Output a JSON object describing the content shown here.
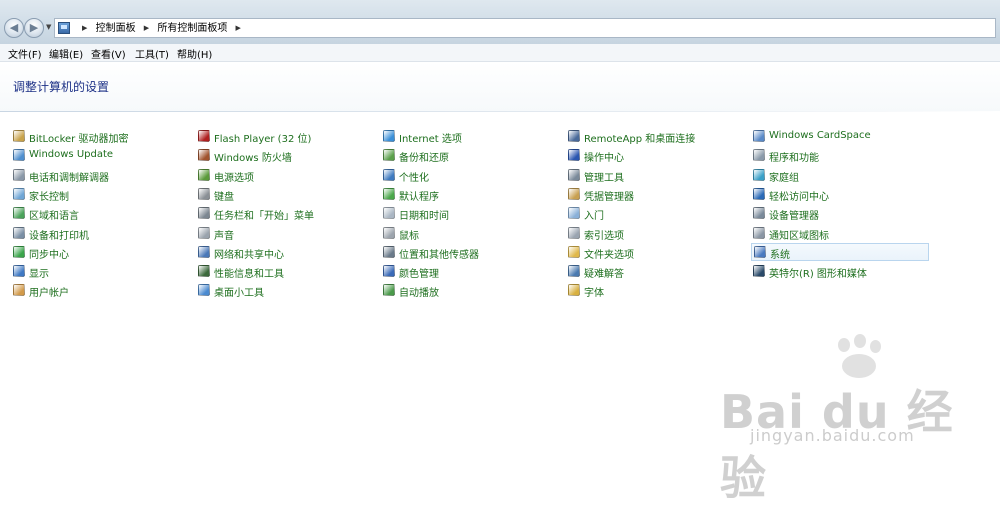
{
  "breadcrumb": [
    "控制面板",
    "所有控制面板项"
  ],
  "menu": [
    "文件(F)",
    "编辑(E)",
    "查看(V)",
    "工具(T)",
    "帮助(H)"
  ],
  "page_title": "调整计算机的设置",
  "columns": [
    [
      {
        "label": "BitLocker 驱动器加密",
        "icon": "bitlocker-icon",
        "color": "#c8a24a"
      },
      {
        "label": "Windows Update",
        "icon": "windows-update-icon",
        "color": "#4f8fcf"
      },
      {
        "label": "电话和调制解调器",
        "icon": "phone-modem-icon",
        "color": "#8a98a8"
      },
      {
        "label": "家长控制",
        "icon": "parental-controls-icon",
        "color": "#6fa6d6"
      },
      {
        "label": "区域和语言",
        "icon": "region-language-icon",
        "color": "#4aa35a"
      },
      {
        "label": "设备和打印机",
        "icon": "devices-printers-icon",
        "color": "#7a8fa5"
      },
      {
        "label": "同步中心",
        "icon": "sync-center-icon",
        "color": "#3aa54a"
      },
      {
        "label": "显示",
        "icon": "display-icon",
        "color": "#3f79c4"
      },
      {
        "label": "用户帐户",
        "icon": "user-accounts-icon",
        "color": "#d29a4a"
      }
    ],
    [
      {
        "label": "Flash Player (32 位)",
        "icon": "flash-player-icon",
        "color": "#b02020"
      },
      {
        "label": "Windows 防火墙",
        "icon": "firewall-icon",
        "color": "#a0522d"
      },
      {
        "label": "电源选项",
        "icon": "power-options-icon",
        "color": "#5a9a3a"
      },
      {
        "label": "键盘",
        "icon": "keyboard-icon",
        "color": "#8a8f95"
      },
      {
        "label": "任务栏和「开始」菜单",
        "icon": "taskbar-icon",
        "color": "#7d8791"
      },
      {
        "label": "声音",
        "icon": "sound-icon",
        "color": "#9aa3ad"
      },
      {
        "label": "网络和共享中心",
        "icon": "network-sharing-icon",
        "color": "#4a78b8"
      },
      {
        "label": "性能信息和工具",
        "icon": "performance-icon",
        "color": "#3c6a3c"
      },
      {
        "label": "桌面小工具",
        "icon": "gadgets-icon",
        "color": "#4a8ad0"
      }
    ],
    [
      {
        "label": "Internet 选项",
        "icon": "internet-options-icon",
        "color": "#3a8fd8"
      },
      {
        "label": "备份和还原",
        "icon": "backup-restore-icon",
        "color": "#5aa04a"
      },
      {
        "label": "个性化",
        "icon": "personalization-icon",
        "color": "#3f7ac0"
      },
      {
        "label": "默认程序",
        "icon": "default-programs-icon",
        "color": "#4aa84a"
      },
      {
        "label": "日期和时间",
        "icon": "date-time-icon",
        "color": "#aab6c3"
      },
      {
        "label": "鼠标",
        "icon": "mouse-icon",
        "color": "#9ca4ad"
      },
      {
        "label": "位置和其他传感器",
        "icon": "location-sensors-icon",
        "color": "#6a7a8a"
      },
      {
        "label": "颜色管理",
        "icon": "color-management-icon",
        "color": "#3a6ab8"
      },
      {
        "label": "自动播放",
        "icon": "autoplay-icon",
        "color": "#4a9a4a"
      }
    ],
    [
      {
        "label": "RemoteApp 和桌面连接",
        "icon": "remoteapp-icon",
        "color": "#4a6a9a"
      },
      {
        "label": "操作中心",
        "icon": "action-center-icon",
        "color": "#2a56b0"
      },
      {
        "label": "管理工具",
        "icon": "admin-tools-icon",
        "color": "#7a8a9a"
      },
      {
        "label": "凭据管理器",
        "icon": "credential-manager-icon",
        "color": "#c8a050"
      },
      {
        "label": "入门",
        "icon": "getting-started-icon",
        "color": "#8ab0d8"
      },
      {
        "label": "索引选项",
        "icon": "indexing-options-icon",
        "color": "#9aa4b0"
      },
      {
        "label": "文件夹选项",
        "icon": "folder-options-icon",
        "color": "#e0b84a"
      },
      {
        "label": "疑难解答",
        "icon": "troubleshooting-icon",
        "color": "#4a7ab0"
      },
      {
        "label": "字体",
        "icon": "fonts-icon",
        "color": "#d8b040"
      }
    ],
    [
      {
        "label": "Windows CardSpace",
        "icon": "cardspace-icon",
        "color": "#5a8ac8"
      },
      {
        "label": "程序和功能",
        "icon": "programs-features-icon",
        "color": "#8a9aaa"
      },
      {
        "label": "家庭组",
        "icon": "homegroup-icon",
        "color": "#3aa0c8"
      },
      {
        "label": "轻松访问中心",
        "icon": "ease-of-access-icon",
        "color": "#2a6ab8"
      },
      {
        "label": "设备管理器",
        "icon": "device-manager-icon",
        "color": "#7a8a9a"
      },
      {
        "label": "通知区域图标",
        "icon": "notification-icons-icon",
        "color": "#8a96a4"
      },
      {
        "label": "系统",
        "icon": "system-icon",
        "color": "#4a7ac0",
        "selected": true
      },
      {
        "label": "英特尔(R) 图形和媒体",
        "icon": "intel-graphics-icon",
        "color": "#2a4a6a"
      }
    ]
  ],
  "watermark": {
    "brand": "Bai du 经验",
    "url": "jingyan.baidu.com"
  }
}
